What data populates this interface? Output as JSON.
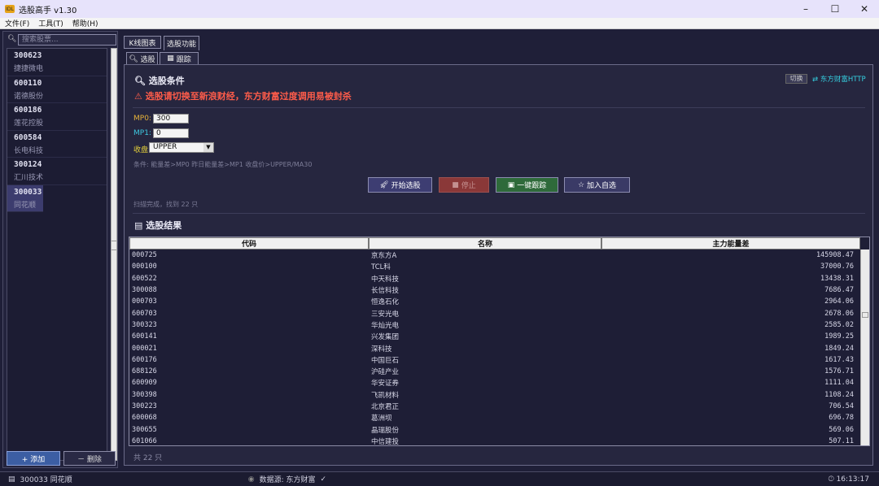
{
  "app": {
    "title": "选股高手 v1.30",
    "icon_text": "IDL"
  },
  "menu": [
    "文件(F)",
    "工具(T)",
    "帮助(H)"
  ],
  "sidebar": {
    "search_placeholder": "搜索股票...",
    "items": [
      {
        "code": "300623",
        "name": "捷捷微电"
      },
      {
        "code": "600110",
        "name": "诺德股份"
      },
      {
        "code": "600186",
        "name": "莲花控股"
      },
      {
        "code": "600584",
        "name": "长电科技"
      },
      {
        "code": "300124",
        "name": "汇川技术"
      },
      {
        "code": "300033",
        "name": "同花顺"
      }
    ],
    "add_label": "+ 添加",
    "delete_label": "－ 删除"
  },
  "tabs_top": [
    "K线图表",
    "选股功能"
  ],
  "tabs_sub": [
    "选股",
    "跟踪"
  ],
  "panel": {
    "title": "选股条件",
    "warning": "选股请切换至新浪财经，东方财富过度调用易被封杀",
    "switch_label": "切换",
    "source_label": "东方财富HTTP",
    "mp0_label": "MP0:",
    "mp0_value": "300",
    "mp1_label": "MP1:",
    "mp1_value": "0",
    "close_label": "收盘>:",
    "close_value": "UPPER",
    "conditions": "条件: 能量差>MP0   昨日能量差>MP1   收盘价>UPPER/MA30",
    "buttons": {
      "start": "开始选股",
      "stop": "停止",
      "track": "一键跟踪",
      "watch": "加入自选"
    },
    "status": "扫描完成，找到 22 只",
    "results_title": "选股结果",
    "columns": [
      "代码",
      "名称",
      "主力能量差"
    ],
    "rows": [
      [
        "000725",
        "京东方A",
        "145908.47"
      ],
      [
        "000100",
        "TCL科",
        "37000.76"
      ],
      [
        "600522",
        "中天科技",
        "13438.31"
      ],
      [
        "300088",
        "长信科技",
        "7686.47"
      ],
      [
        "000703",
        "恒逸石化",
        "2964.06"
      ],
      [
        "600703",
        "三安光电",
        "2678.06"
      ],
      [
        "300323",
        "华灿光电",
        "2585.02"
      ],
      [
        "600141",
        "兴发集团",
        "1989.25"
      ],
      [
        "000021",
        "深科技",
        "1849.24"
      ],
      [
        "600176",
        "中国巨石",
        "1617.43"
      ],
      [
        "688126",
        "沪硅产业",
        "1576.71"
      ],
      [
        "600909",
        "华安证券",
        "1111.04"
      ],
      [
        "300398",
        "飞凯材料",
        "1108.24"
      ],
      [
        "300223",
        "北京君正",
        "706.54"
      ],
      [
        "600068",
        "葛洲坝",
        "696.78"
      ],
      [
        "300655",
        "晶瑞股份",
        "569.06"
      ],
      [
        "601066",
        "中信建投",
        "507.11"
      ]
    ],
    "count": "共 22 只"
  },
  "status_bar": {
    "selected": "300033 同花顺",
    "source": "数据源: 东方财富",
    "check": "✓",
    "time": "16:13:17"
  }
}
